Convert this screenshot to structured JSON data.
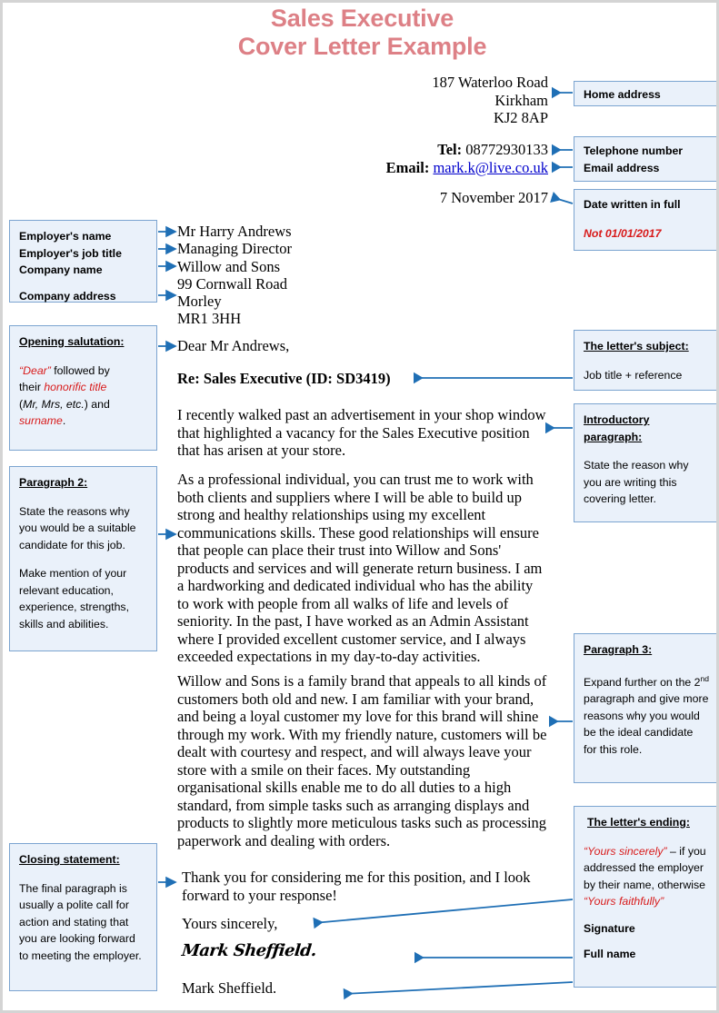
{
  "title": {
    "line1": "Sales Executive",
    "line2": "Cover Letter Example",
    "color": "#dd8086"
  },
  "letter": {
    "sender_address": {
      "street": "187 Waterloo Road",
      "town": "Kirkham",
      "postcode": "KJ2 8AP"
    },
    "contact": {
      "tel_label": "Tel:",
      "tel_value": "08772930133",
      "email_label": "Email:",
      "email_value": "mark.k@live.co.uk"
    },
    "date": "7 November 2017",
    "recipient": {
      "name": "Mr Harry Andrews",
      "job_title": "Managing Director",
      "company": "Willow and Sons",
      "address_line1": "99 Cornwall Road",
      "address_line2": "Morley",
      "postcode": "MR1 3HH"
    },
    "salutation": "Dear Mr Andrews,",
    "subject": "Re: Sales Executive (ID: SD3419)",
    "paragraph_intro": "I recently walked past an advertisement in your shop window that highlighted a vacancy for the Sales Executive position that has arisen at your store.",
    "paragraph_two": "As a professional individual, you can trust me to work with both clients and suppliers where I will be able to build up strong and healthy relationships using my excellent communications skills. These good relationships will ensure that people can place their trust into Willow and Sons' products and services and will generate return business. I am a hardworking and dedicated individual who has the ability to work with people from all walks of life and levels of seniority. In the past, I have worked as an Admin Assistant where I provided excellent customer service, and I always exceeded expectations in my day-to-day activities.",
    "paragraph_three": "Willow and Sons is a family brand that appeals to all kinds of customers both old and new. I am familiar with your brand, and being a loyal customer my love for this brand will shine through my work. With my friendly nature, customers will be dealt with courtesy and respect, and will always leave your store with a smile on their faces. My outstanding organisational skills enable me to do all duties to a high standard, from simple tasks such as arranging displays and products to slightly more meticulous tasks such as processing paperwork and dealing with orders.",
    "paragraph_closing": "Thank you for considering me for this position, and I look forward to your response!",
    "sign_off": "Yours sincerely,",
    "signature": "Mark Sheffield.",
    "full_name": "Mark Sheffield."
  },
  "notes": {
    "home_address": {
      "label": "Home address"
    },
    "contact": {
      "telephone": "Telephone number",
      "email": "Email address"
    },
    "date": {
      "heading": "Date written in full",
      "warning": "Not 01/01/2017"
    },
    "employer": {
      "line1": "Employer's name",
      "line2": "Employer's job title",
      "line3": "Company name",
      "line4": "Company address"
    },
    "salutation": {
      "heading": "Opening salutation:",
      "part1": "“Dear”",
      "part2": " followed by",
      "part3": "their ",
      "part4": "honorific title",
      "part5": "(",
      "part6": "Mr, Mrs, etc.",
      "part7": ") and",
      "part8": "surname",
      "part9": "."
    },
    "subject": {
      "heading": "The letter's subject:",
      "body": "Job title + reference"
    },
    "intro": {
      "heading_line1": "Introductory",
      "heading_line2": "paragraph:",
      "body": "State the reason why you are writing this covering letter."
    },
    "paragraph2": {
      "heading": "Paragraph 2:",
      "body1": "State the reasons why you would be a suitable candidate for this job.",
      "body2": "Make mention of your relevant education, experience, strengths, skills and abilities."
    },
    "paragraph3": {
      "heading": "Paragraph 3:",
      "body_pre": "Expand further on the 2",
      "body_sup": "nd",
      "body_post": " paragraph and give more reasons why you would be the ideal candidate for this role."
    },
    "ending": {
      "heading": "The letter's ending:",
      "quote1": "“Yours sincerely”",
      "mid": " – if you addressed the employer by their name, otherwise",
      "quote2": "“Yours faithfully”",
      "signature_label": "Signature",
      "fullname_label": "Full name"
    },
    "closing": {
      "heading": "Closing statement:",
      "body": "The final paragraph is usually a polite call for action and stating that you are looking forward to meeting the employer."
    }
  },
  "colors": {
    "accent_title": "#dd8086",
    "note_fill": "#eaf1fa",
    "note_border": "#7ba4d0",
    "arrow": "#1f6fb5",
    "red_text": "#d81b1b",
    "link": "#0000cc"
  }
}
